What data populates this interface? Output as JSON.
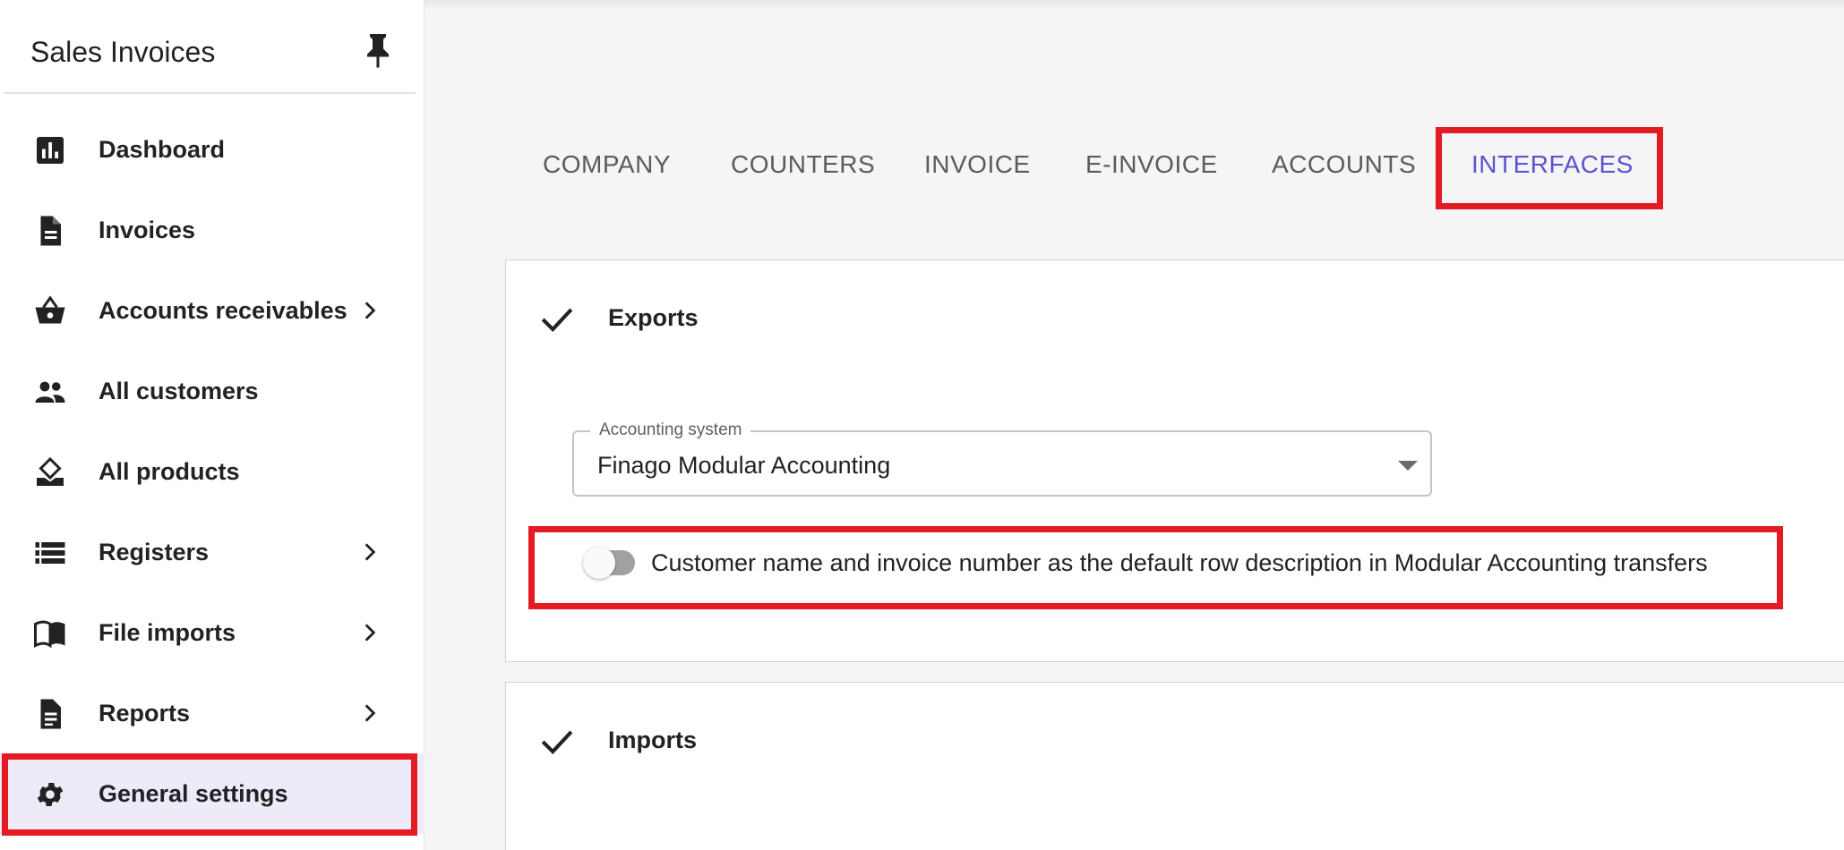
{
  "app": {
    "title": "Sales Invoices"
  },
  "sidebar": {
    "items": [
      {
        "label": "Dashboard",
        "icon": "bar-chart-icon",
        "has_chevron": false
      },
      {
        "label": "Invoices",
        "icon": "document-icon",
        "has_chevron": false
      },
      {
        "label": "Accounts receivables",
        "icon": "basket-icon",
        "has_chevron": true
      },
      {
        "label": "All customers",
        "icon": "people-icon",
        "has_chevron": false
      },
      {
        "label": "All products",
        "icon": "product-icon",
        "has_chevron": false
      },
      {
        "label": "Registers",
        "icon": "list-icon",
        "has_chevron": true
      },
      {
        "label": "File imports",
        "icon": "book-icon",
        "has_chevron": true
      },
      {
        "label": "Reports",
        "icon": "report-icon",
        "has_chevron": true
      },
      {
        "label": "General settings",
        "icon": "gear-icon",
        "has_chevron": false,
        "active": true
      }
    ]
  },
  "tabs": [
    {
      "label": "COMPANY"
    },
    {
      "label": "COUNTERS"
    },
    {
      "label": "INVOICE"
    },
    {
      "label": "E-INVOICE"
    },
    {
      "label": "ACCOUNTS"
    },
    {
      "label": "INTERFACES",
      "active": true
    }
  ],
  "exports": {
    "title": "Exports",
    "accounting_system": {
      "label": "Accounting system",
      "value": "Finago Modular Accounting"
    },
    "toggle": {
      "label": "Customer name and invoice number as the default row description in Modular Accounting transfers",
      "checked": false
    }
  },
  "imports": {
    "title": "Imports"
  },
  "colors": {
    "accent": "#5a54d0",
    "highlight": "#e41b23",
    "active_nav_bg": "#eeeaf8"
  }
}
